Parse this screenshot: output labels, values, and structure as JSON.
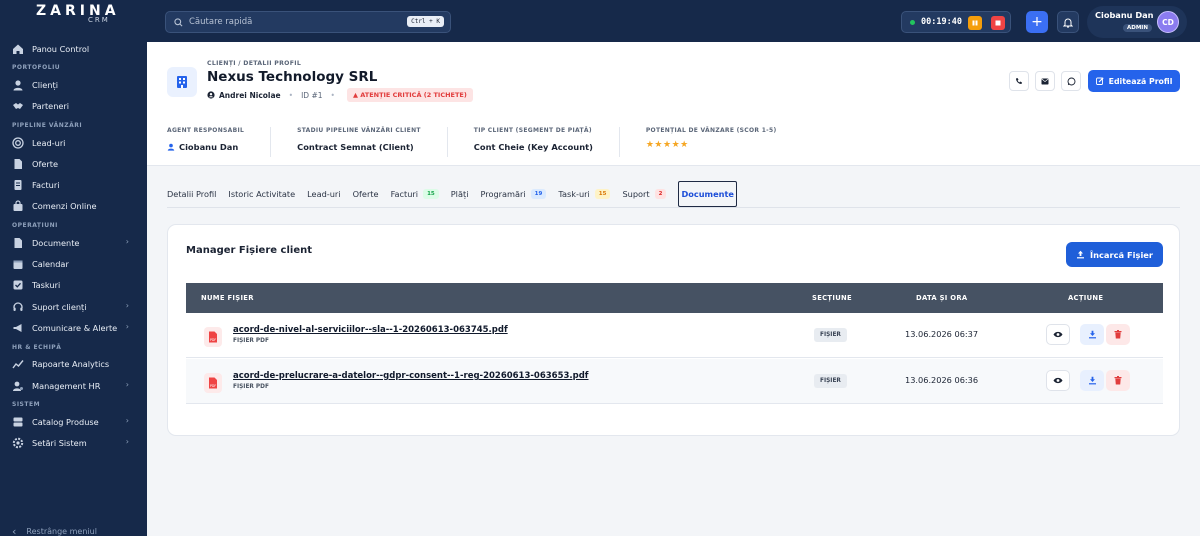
{
  "app": {
    "brand": "ZARINA",
    "brand_sub": "CRM"
  },
  "sidebar": {
    "items": [
      {
        "label": "Panou Control"
      },
      {
        "section": "PORTOFOLIU"
      },
      {
        "label": "Clienți"
      },
      {
        "label": "Parteneri"
      },
      {
        "section": "PIPELINE VÂNZĂRI"
      },
      {
        "label": "Lead-uri"
      },
      {
        "label": "Oferte"
      },
      {
        "label": "Facturi"
      },
      {
        "label": "Comenzi Online"
      },
      {
        "section": "OPERAȚIUNI"
      },
      {
        "label": "Documente"
      },
      {
        "label": "Calendar"
      },
      {
        "label": "Taskuri"
      },
      {
        "label": "Suport clienți"
      },
      {
        "label": "Comunicare & Alerte"
      },
      {
        "section": "HR & ECHIPĂ"
      },
      {
        "label": "Rapoarte Analytics"
      },
      {
        "label": "Management HR"
      },
      {
        "section": "SISTEM"
      },
      {
        "label": "Catalog Produse"
      },
      {
        "label": "Setări Sistem"
      }
    ],
    "collapse_label": "Restrânge meniul"
  },
  "topbar": {
    "search_placeholder": "Căutare rapidă",
    "search_shortcut": "Ctrl + K",
    "timer": "00:19:40",
    "user_name": "Ciobanu Dan",
    "user_role": "ADMIN",
    "user_initials": "CD"
  },
  "profile": {
    "breadcrumb": "CLIENȚI / DETALII PROFIL",
    "title": "Nexus Technology SRL",
    "contact": "Andrei Nicolae",
    "id": "ID #1",
    "alert": "ATENȚIE CRITICĂ (2 TICHETE)",
    "edit_label": "Editează Profil",
    "stats": [
      {
        "label": "AGENT RESPONSABIL",
        "value": "Ciobanu Dan"
      },
      {
        "label": "STADIU PIPELINE VÂNZĂRI CLIENT",
        "value": "Contract Semnat (Client)"
      },
      {
        "label": "TIP CLIENT (SEGMENT DE PIAȚĂ)",
        "value": "Cont Cheie (Key Account)"
      },
      {
        "label": "POTENȚIAL DE VÂNZARE (SCOR 1-5)",
        "value": "★★★★★",
        "score": 5
      }
    ]
  },
  "tabs": [
    {
      "label": "Detalii Profil"
    },
    {
      "label": "Istoric Activitate"
    },
    {
      "label": "Lead-uri"
    },
    {
      "label": "Oferte"
    },
    {
      "label": "Facturi",
      "count": "15",
      "color": "#16a34a",
      "bg": "#dcfce7"
    },
    {
      "label": "Plăți"
    },
    {
      "label": "Programări",
      "count": "19",
      "color": "#2563eb",
      "bg": "#dbeafe"
    },
    {
      "label": "Task-uri",
      "count": "15",
      "color": "#d97706",
      "bg": "#fef3c7"
    },
    {
      "label": "Suport",
      "count": "2",
      "color": "#dc2626",
      "bg": "#fee2e2"
    },
    {
      "label": "Documente",
      "active": true
    }
  ],
  "files": {
    "title": "Manager Fișiere client",
    "upload_label": "Încarcă Fișier",
    "columns": [
      "NUME FIȘIER",
      "SECȚIUNE",
      "DATA ȘI ORA",
      "ACȚIUNE"
    ],
    "rows": [
      {
        "name": "acord-de-nivel-al-serviciilor--sla--1-20260613-063745.pdf",
        "type": "FIȘIER PDF",
        "section": "FIȘIER",
        "date": "13.06.2026 06:37"
      },
      {
        "name": "acord-de-prelucrare-a-datelor--gdpr-consent--1-reg-20260613-063653.pdf",
        "type": "FIȘIER PDF",
        "section": "FIȘIER",
        "date": "13.06.2026 06:36"
      }
    ]
  },
  "colors": {
    "sidebar": "#16294a",
    "accent": "#2563eb",
    "danger": "#e13c3c"
  }
}
